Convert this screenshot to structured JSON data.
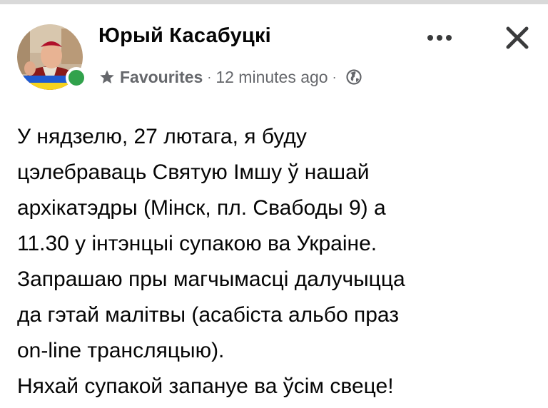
{
  "author": {
    "name": "Юрый Касабуцкі",
    "online": true
  },
  "meta": {
    "audience_icon": "star-icon",
    "audience_label": "Favourites",
    "separator": "·",
    "timestamp": "12 minutes ago",
    "privacy_icon": "globe-icon"
  },
  "actions": {
    "more_icon": "more-horizontal-icon",
    "close_icon": "close-icon"
  },
  "post": {
    "lines": [
      "У нядзелю, 27 лютага, я буду",
      "цэлебраваць Святую Імшу ў нашай",
      "архікатэдры (Мінск, пл. Свабоды 9) а",
      "11.30 у інтэнцыі супакою ва Украіне.",
      "Запрашаю пры магчымасці далучыцца",
      "да гэтай малітвы (асабіста альбо праз",
      "on-line трансляцыю).",
      "Няхай супакой запануе ва ўсім свеце!"
    ]
  },
  "colors": {
    "text": "#050505",
    "meta": "#65676b",
    "online": "#31a24c",
    "top_border": "#d9d9d9"
  }
}
